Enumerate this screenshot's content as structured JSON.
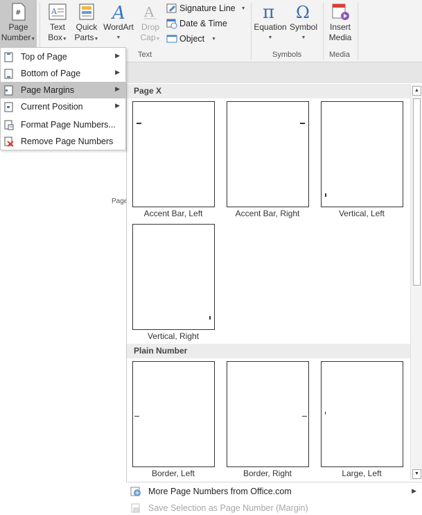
{
  "ribbon": {
    "page_number": {
      "line1": "Page",
      "line2": "Number"
    },
    "text_box": {
      "line1": "Text",
      "line2": "Box"
    },
    "quick_parts": {
      "line1": "Quick",
      "line2": "Parts"
    },
    "wordart": {
      "label": "WordArt"
    },
    "drop_cap": {
      "line1": "Drop",
      "line2": "Cap"
    },
    "signature_line": "Signature Line",
    "date_time": "Date & Time",
    "object": "Object",
    "text_group": "Text",
    "equation": "Equation",
    "symbol": "Symbol",
    "symbols_group": "Symbols",
    "insert_media": {
      "line1": "Insert",
      "line2": "Media"
    },
    "media_group": "Media"
  },
  "menu": {
    "items": [
      {
        "label": "Top of Page",
        "submenu": true
      },
      {
        "label": "Bottom of Page",
        "submenu": true
      },
      {
        "label": "Page Margins",
        "submenu": true,
        "selected": true
      },
      {
        "label": "Current Position",
        "submenu": true
      },
      {
        "label": "Format Page Numbers...",
        "submenu": false
      },
      {
        "label": "Remove Page Numbers",
        "submenu": false
      }
    ]
  },
  "doc": {
    "faint_text": "Page"
  },
  "gallery": {
    "sections": [
      {
        "title": "Page X",
        "items": [
          "Accent Bar, Left",
          "Accent Bar, Right",
          "Vertical, Left",
          "Vertical, Right"
        ]
      },
      {
        "title": "Plain Number",
        "items": [
          "Border, Left",
          "Border, Right",
          "Large, Left"
        ]
      }
    ]
  },
  "footer": {
    "more": "More Page Numbers from Office.com",
    "save": "Save Selection as Page Number (Margin)"
  }
}
